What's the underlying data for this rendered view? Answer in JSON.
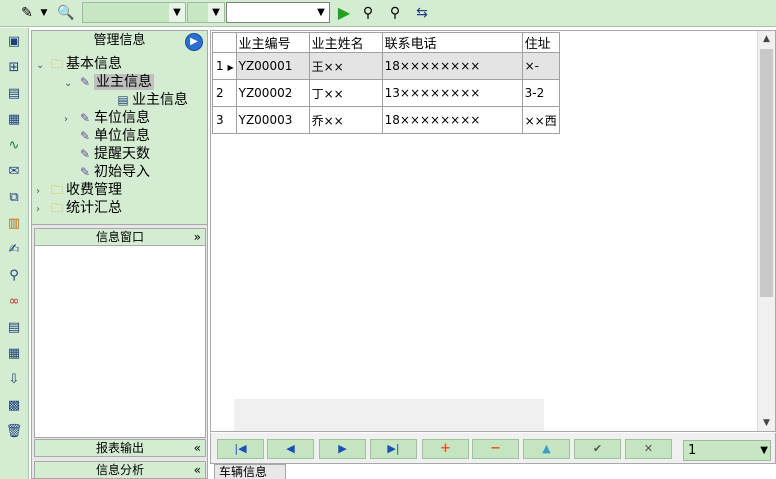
{
  "toolbar": {
    "combo1_value": "",
    "combo2_value": "",
    "combo3_value": "",
    "icons": [
      "pencil-icon",
      "dropdown-arrow",
      "search-doc-icon",
      "run-icon",
      "find-icon",
      "find-next-icon",
      "refresh-icon"
    ]
  },
  "nav": {
    "title": "管理信息",
    "tree": [
      {
        "label": "基本信息",
        "icon": "folder-icon",
        "level": 0,
        "expanded": true
      },
      {
        "label": "业主信息",
        "icon": "leaf-icon",
        "level": 1,
        "expanded": true,
        "selected": true
      },
      {
        "label": "业主信息",
        "icon": "form-icon",
        "level": 2
      },
      {
        "label": "车位信息",
        "icon": "leaf-icon",
        "level": 1,
        "expanded": false
      },
      {
        "label": "单位信息",
        "icon": "leaf-icon",
        "level": 1
      },
      {
        "label": "提醒天数",
        "icon": "leaf-icon",
        "level": 1
      },
      {
        "label": "初始导入",
        "icon": "leaf-icon",
        "level": 1
      },
      {
        "label": "收费管理",
        "icon": "folder-icon",
        "level": 0,
        "expanded": false
      },
      {
        "label": "统计汇总",
        "icon": "folder-icon",
        "level": 0,
        "expanded": false
      }
    ],
    "info_window": "信息窗口",
    "report_output": "报表输出",
    "info_analysis": "信息分析"
  },
  "grid": {
    "columns": [
      "业主编号",
      "业主姓名",
      "联系电话",
      "住址"
    ],
    "rows": [
      {
        "no": "1",
        "marker": "▶",
        "id": "YZ00001",
        "name": "王××",
        "phone": "18××××××××",
        "addr": "×-"
      },
      {
        "no": "2",
        "marker": "",
        "id": "YZ00002",
        "name": "丁××",
        "phone": "13××××××××",
        "addr": "3-2"
      },
      {
        "no": "3",
        "marker": "",
        "id": "YZ00003",
        "name": "乔××",
        "phone": "18××××××××",
        "addr": "××西"
      }
    ]
  },
  "navbar": {
    "first": "|◀",
    "prev": "◀",
    "next": "▶",
    "last": "▶|",
    "add": "+",
    "delete": "−",
    "up": "▲",
    "confirm": "✔",
    "cancel": "✕",
    "page_value": "1"
  },
  "subtab_label": "车辆信息"
}
